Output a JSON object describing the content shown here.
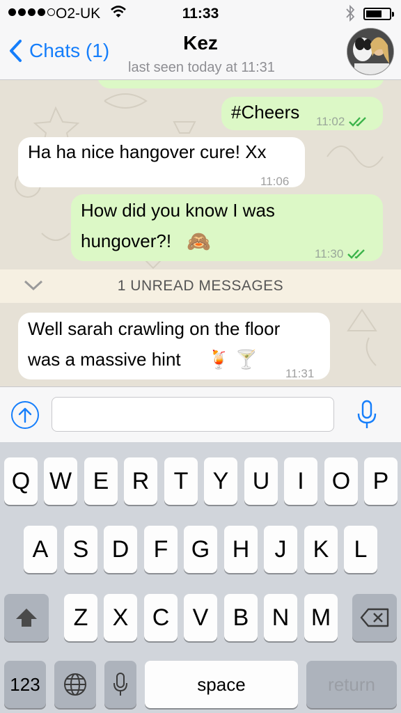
{
  "status_bar": {
    "carrier": "O2-UK",
    "time": "11:33",
    "signal_bars_filled": 4,
    "signal_bars_total": 5,
    "battery_level": 0.6
  },
  "nav": {
    "back_label": "Chats (1)",
    "contact_name": "Kez",
    "last_seen": "last seen today at 11:31"
  },
  "messages": [
    {
      "direction": "out",
      "text": "#Cheers",
      "time": "11:02",
      "read": true
    },
    {
      "direction": "in",
      "text": "Ha ha nice hangover cure! Xx",
      "time": "11:06"
    },
    {
      "direction": "out",
      "line1": "How did you know I was",
      "line2": "hungover?!",
      "emoji": "🙈",
      "time": "11:30",
      "read": true
    },
    {
      "direction": "in",
      "line1": "Well sarah crawling on the floor",
      "line2": "was a massive hint",
      "emoji": "🍹 🍸",
      "time": "11:31"
    }
  ],
  "unread_banner": "1 UNREAD MESSAGES",
  "input": {
    "value": "",
    "placeholder": ""
  },
  "keyboard": {
    "row1": [
      "Q",
      "W",
      "E",
      "R",
      "T",
      "Y",
      "U",
      "I",
      "O",
      "P"
    ],
    "row2": [
      "A",
      "S",
      "D",
      "F",
      "G",
      "H",
      "J",
      "K",
      "L"
    ],
    "row3": [
      "Z",
      "X",
      "C",
      "V",
      "B",
      "N",
      "M"
    ],
    "numbers_label": "123",
    "space_label": "space",
    "return_label": "return"
  },
  "colors": {
    "accent": "#157efb",
    "outgoing_bubble": "#dcf8c6",
    "incoming_bubble": "#ffffff",
    "read_ticks": "#3cb44b"
  }
}
